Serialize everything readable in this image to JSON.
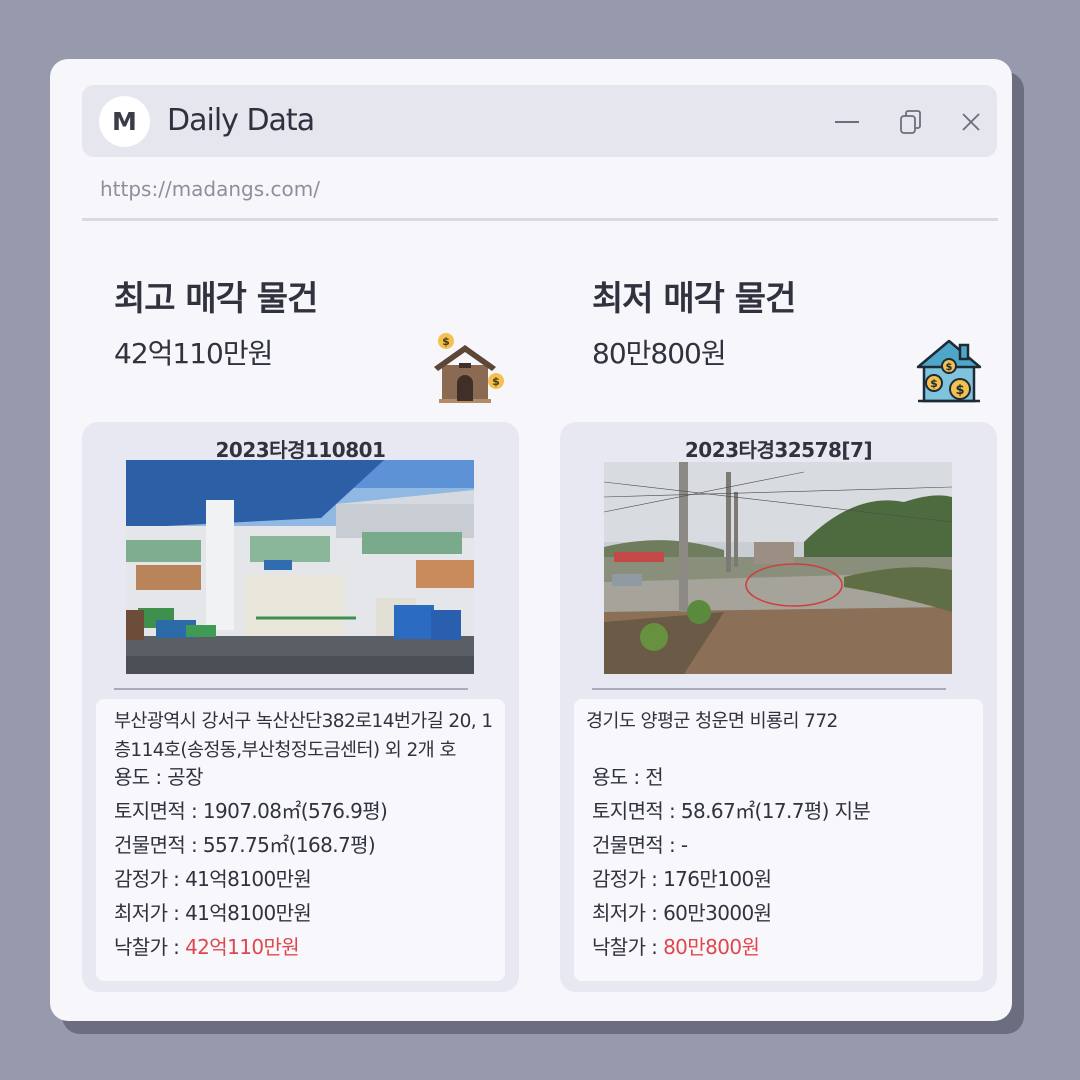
{
  "window": {
    "avatar_letter": "M",
    "app_title": "Daily Data",
    "url": "https://madangs.com/"
  },
  "icons": {
    "minimize": "minimize-icon",
    "restore": "restore-icon",
    "close": "close-icon",
    "left_property": "house-with-coins-icon",
    "right_property": "house-dollar-icon"
  },
  "highest": {
    "heading": "최고 매각 물건",
    "price": "42억110만원",
    "case_no": "2023타경110801",
    "address": "부산광역시 강서구 녹산산단382로14번가길 20, 1층114호(송정동,부산청정도금센터) 외 2개 호",
    "usage_label": "용도 : ",
    "usage": "공장",
    "land_label": "토지면적 : ",
    "land": "1907.08㎡(576.9평)",
    "building_label": "건물면적 : ",
    "building": "557.75㎡(168.7평)",
    "appraisal_label": "감정가 : ",
    "appraisal": "41억8100만원",
    "minimum_label": "최저가 : ",
    "minimum": "41억8100만원",
    "winning_label": "낙찰가 : ",
    "winning": "42억110만원"
  },
  "lowest": {
    "heading": "최저 매각 물건",
    "price": "80만800원",
    "case_no": "2023타경32578[7]",
    "address": "경기도 양평군 청운면 비룡리 772",
    "usage_label": "용도 : ",
    "usage": "전",
    "land_label": "토지면적 : ",
    "land": "58.67㎡(17.7평) 지분",
    "building_label": "건물면적 : ",
    "building": "-",
    "appraisal_label": "감정가 : ",
    "appraisal": "176만100원",
    "minimum_label": "최저가 : ",
    "minimum": "60만3000원",
    "winning_label": "낙찰가 : ",
    "winning": "80만800원"
  },
  "colors": {
    "background": "#9799ad",
    "window": "#f6f6fb",
    "card": "#e7e8f2",
    "accent_red": "#e0474c"
  }
}
